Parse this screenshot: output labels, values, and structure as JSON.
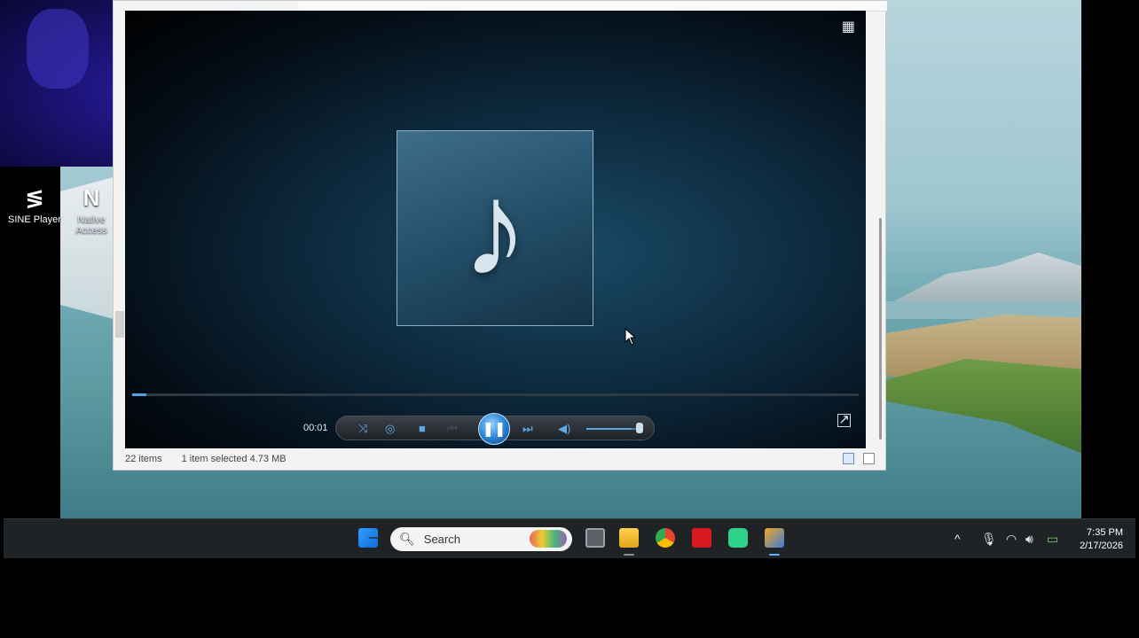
{
  "desktop": {
    "icons": [
      {
        "label": "SINE Player",
        "icon": "sine-player-icon"
      },
      {
        "label": "Native Access",
        "icon": "native-access-icon"
      }
    ]
  },
  "explorer": {
    "status": {
      "items_count": "22 items",
      "selected": "1 item selected",
      "size": "4.73 MB"
    }
  },
  "player": {
    "time": "00:01",
    "progress": 0.02,
    "volume": 0.85,
    "album_art_icon": "music-note-icon",
    "accent_color": "#5fa8e6"
  },
  "taskbar": {
    "search_placeholder": "Search",
    "apps": [
      "windows-start-icon",
      "search-icon",
      "task-view-icon",
      "file-explorer-icon",
      "chrome-icon",
      "amd-icon",
      "android-app-icon",
      "media-player-icon"
    ],
    "clock": {
      "time": "7:35 PM",
      "date": "2/17/2026"
    }
  }
}
